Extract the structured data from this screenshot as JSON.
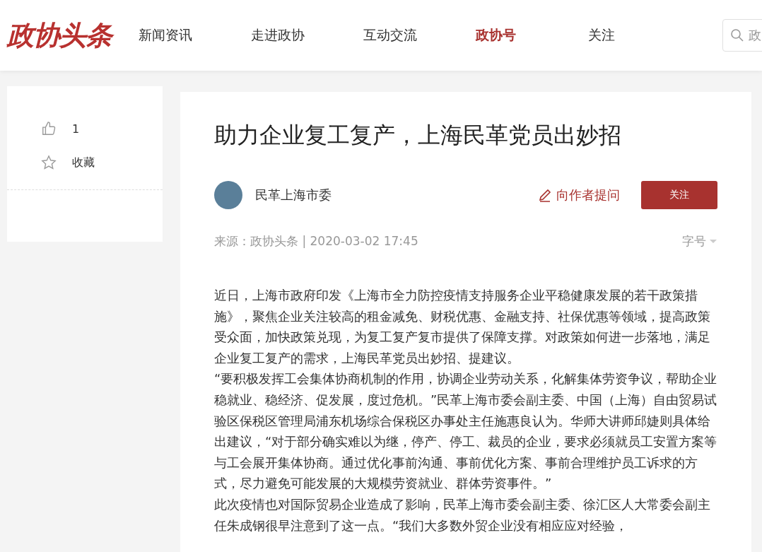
{
  "header": {
    "logo": "政协头条",
    "nav": [
      {
        "label": "新闻资讯",
        "selected": false
      },
      {
        "label": "走进政协",
        "selected": false
      },
      {
        "label": "互动交流",
        "selected": false
      },
      {
        "label": "政协号",
        "selected": true
      },
      {
        "label": "关注",
        "selected": false
      }
    ],
    "search": {
      "placeholder": "政"
    }
  },
  "sidebar": {
    "like": {
      "count": "1"
    },
    "favorite": {
      "label": "收藏"
    }
  },
  "article": {
    "title": "助力企业复工复产，上海民革党员出妙招",
    "author": {
      "name": "民革上海市委"
    },
    "ask_link": "向作者提问",
    "follow_button": "关注",
    "meta": {
      "source": "来源：政协头条 | 2020-03-02 17:45",
      "font_size": "字号"
    },
    "paragraphs": [
      "近日，上海市政府印发《上海市全力防控疫情支持服务企业平稳健康发展的若干政策措施》，聚焦企业关注较高的租金减免、财税优惠、金融支持、社保优惠等领域，提高政策受众面，加快政策兑现，为复工复产复市提供了保障支撑。对政策如何进一步落地，满足企业复工复产的需求，上海民革党员出妙招、提建议。",
      "“要积极发挥工会集体协商机制的作用，协调企业劳动关系，化解集体劳资争议，帮助企业稳就业、稳经济、促发展，度过危机。”民革上海市委会副主委、中国（上海）自由贸易试验区保税区管理局浦东机场综合保税区办事处主任施惠良认为。华师大讲师邱婕则具体给出建议，“对于部分确实难以为继，停产、停工、裁员的企业，要求必须就员工安置方案等与工会展开集体协商。通过优化事前沟通、事前优化方案、事前合理维护员工诉求的方式，尽力避免可能发展的大规模劳资就业、群体劳资事件。”",
      "此次疫情也对国际贸易企业造成了影响，民革上海市委会副主委、徐汇区人大常委会副主任朱成钢很早注意到了这一点。“我们大多数外贸企业没有相应应对经验，"
    ]
  }
}
